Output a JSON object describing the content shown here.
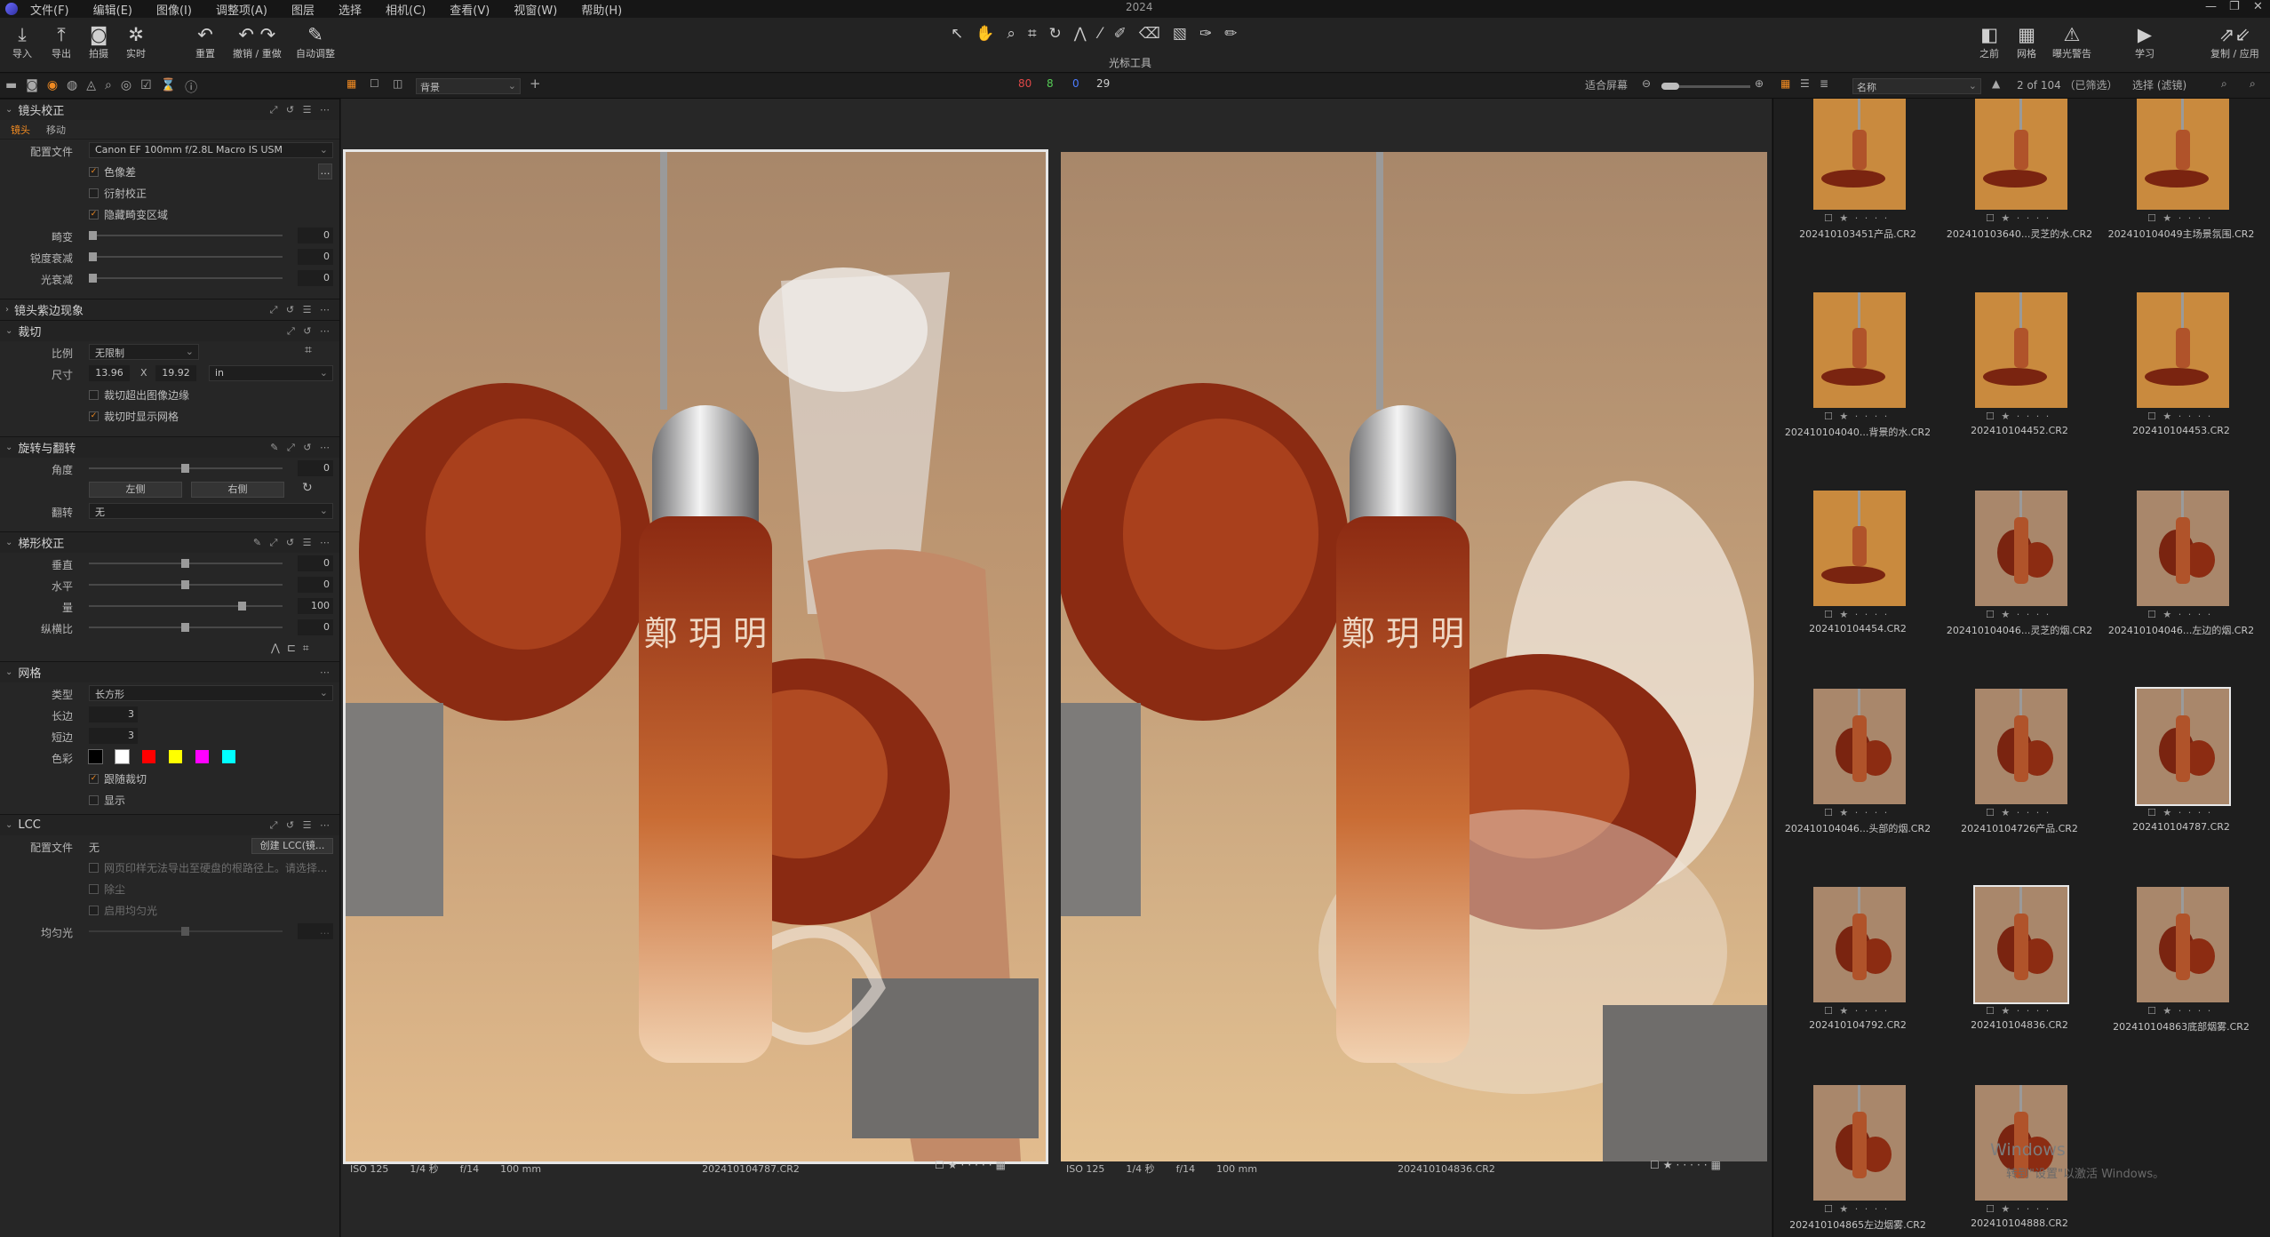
{
  "app": {
    "title": "2024"
  },
  "menu": [
    "文件(F)",
    "编辑(E)",
    "图像(I)",
    "调整项(A)",
    "图层",
    "选择",
    "相机(C)",
    "查看(V)",
    "视窗(W)",
    "帮助(H)"
  ],
  "toolbar": {
    "left": [
      "导入",
      "导出",
      "拍摄",
      "实时",
      "重置",
      "撤销 / 重做",
      "自动调整"
    ],
    "cursor_label": "光标工具",
    "right": [
      "之前",
      "网格",
      "曝光警告",
      "学习",
      "复制 / 应用"
    ]
  },
  "subbar": {
    "viewer_select": "背景",
    "counts": [
      "80",
      "8",
      "0",
      "29"
    ],
    "fit_label": "适合屏幕",
    "sort_select": "名称",
    "count_text": "2 of 104 （已筛选）",
    "filter_label": "选择 (滤镜)"
  },
  "lens": {
    "title": "镜头校正",
    "tabs": [
      "镜头",
      "移动"
    ],
    "profile_label": "配置文件",
    "profile": "Canon EF 100mm f/2.8L Macro IS USM",
    "checks": [
      "色像差",
      "衍射校正",
      "隐藏畸变区域"
    ],
    "sliders": [
      {
        "label": "畸变",
        "value": "0"
      },
      {
        "label": "锐度衰减",
        "value": "0"
      },
      {
        "label": "光衰减",
        "value": "0"
      }
    ]
  },
  "purple": {
    "title": "镜头紫边现象"
  },
  "crop": {
    "title": "裁切",
    "ratio_label": "比例",
    "ratio": "无限制",
    "size_label": "尺寸",
    "w": "13.96",
    "x": "X",
    "h": "19.92",
    "unit": "in",
    "checks": [
      "裁切超出图像边缘",
      "裁切时显示网格"
    ]
  },
  "rotate": {
    "title": "旋转与翻转",
    "angle_label": "角度",
    "angle": "0",
    "left": "左侧",
    "right": "右侧",
    "flip_label": "翻转",
    "flip": "无"
  },
  "keystone": {
    "title": "梯形校正",
    "sliders": [
      {
        "label": "垂直",
        "value": "0"
      },
      {
        "label": "水平",
        "value": "0"
      },
      {
        "label": "量",
        "value": "100"
      },
      {
        "label": "纵横比",
        "value": "0"
      }
    ]
  },
  "grid": {
    "title": "网格",
    "type_label": "类型",
    "type": "长方形",
    "long_label": "长边",
    "long": "3",
    "short_label": "短边",
    "short": "3",
    "color_label": "色彩",
    "colors": [
      "#000000",
      "#ffffff",
      "#ff0000",
      "#ffff00",
      "#ff00ff",
      "#00ffff"
    ],
    "checks": [
      "跟随裁切",
      "显示"
    ]
  },
  "lcc": {
    "title": "LCC",
    "profile_label": "配置文件",
    "profile": "无",
    "create": "创建 LCC(镜...",
    "note": "网页印样无法导出至硬盘的根路径上。请选择...",
    "checks": [
      "除尘",
      "启用均匀光"
    ],
    "uniform_label": "均匀光"
  },
  "viewer": {
    "photos": [
      {
        "iso": "ISO 125",
        "shutter": "1/4 秒",
        "aperture": "f/14",
        "focal": "100 mm",
        "file": "202410104787.CR2"
      },
      {
        "iso": "ISO 125",
        "shutter": "1/4 秒",
        "aperture": "f/14",
        "focal": "100 mm",
        "file": "202410104836.CR2"
      }
    ]
  },
  "browser": {
    "thumbs": [
      "202410103451产品.CR2",
      "202410103640...灵芝的水.CR2",
      "202410104049主场景氛围.CR2",
      "202410104040...背景的水.CR2",
      "202410104452.CR2",
      "202410104453.CR2",
      "202410104454.CR2",
      "202410104046...灵芝的烟.CR2",
      "202410104046...左边的烟.CR2",
      "202410104046...头部的烟.CR2",
      "202410104726产品.CR2",
      "202410104787.CR2",
      "202410104792.CR2",
      "202410104836.CR2",
      "202410104863底部烟雾.CR2",
      "202410104865左边烟雾.CR2",
      "202410104888.CR2"
    ]
  },
  "watermark": {
    "line1": "Windows",
    "line2": "转到\"设置\"以激活 Windows。"
  }
}
